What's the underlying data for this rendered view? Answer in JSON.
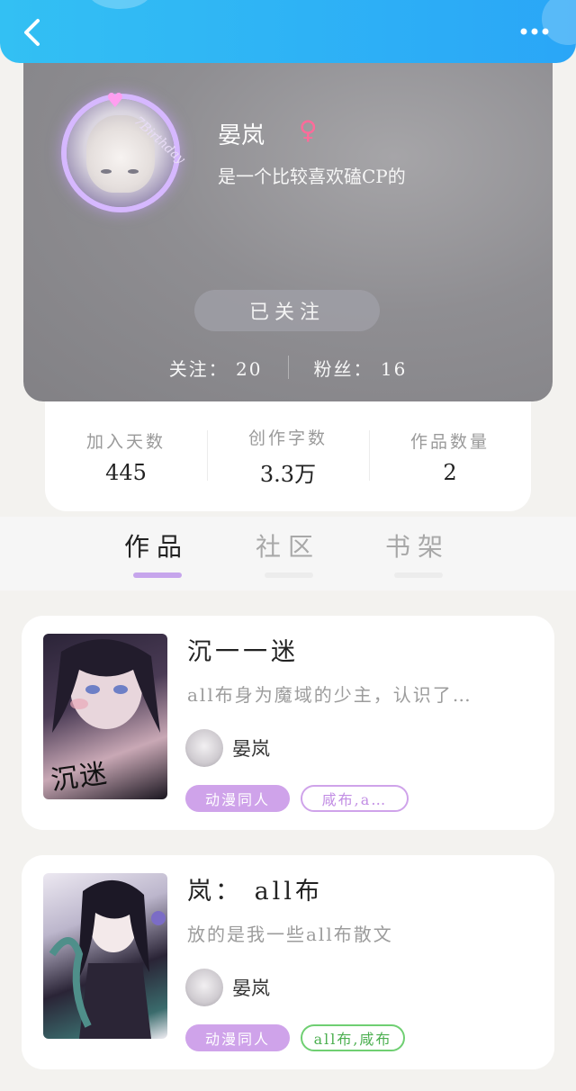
{
  "header": {
    "back_icon": "chevron-left-icon",
    "more_icon": "more-dots-icon"
  },
  "profile": {
    "avatar_stamp": "7Birthday",
    "username": "晏岚",
    "gender_icon": "♀",
    "bio": "是一个比较喜欢磕CP的",
    "follow_label": "已关注",
    "following_text": "关注： 20",
    "followers_text": "粉丝： 16"
  },
  "stats": [
    {
      "label": "加入天数",
      "value": "445"
    },
    {
      "label": "创作字数",
      "value": "3.3万"
    },
    {
      "label": "作品数量",
      "value": "2"
    }
  ],
  "tabs": [
    {
      "label": "作品",
      "active": true
    },
    {
      "label": "社区",
      "active": false
    },
    {
      "label": "书架",
      "active": false
    }
  ],
  "works": [
    {
      "title": "沉一一迷",
      "description": "all布身为魔域的少主，认识了…",
      "cover_text": "沉迷",
      "author": "晏岚",
      "tags": [
        "动漫同人",
        "咸布,a…"
      ]
    },
    {
      "title": "岚： all布",
      "description": "放的是我一些all布散文",
      "cover_text": "",
      "author": "晏岚",
      "tags": [
        "动漫同人",
        "all布,咸布"
      ]
    }
  ],
  "colors": {
    "topbar": "#2aa6f7",
    "tab_active_underline": "#c6a5ec",
    "tag_fill": "#cfa3ea",
    "tag_green": "#6fcf72",
    "gender": "#ff6b9a"
  }
}
